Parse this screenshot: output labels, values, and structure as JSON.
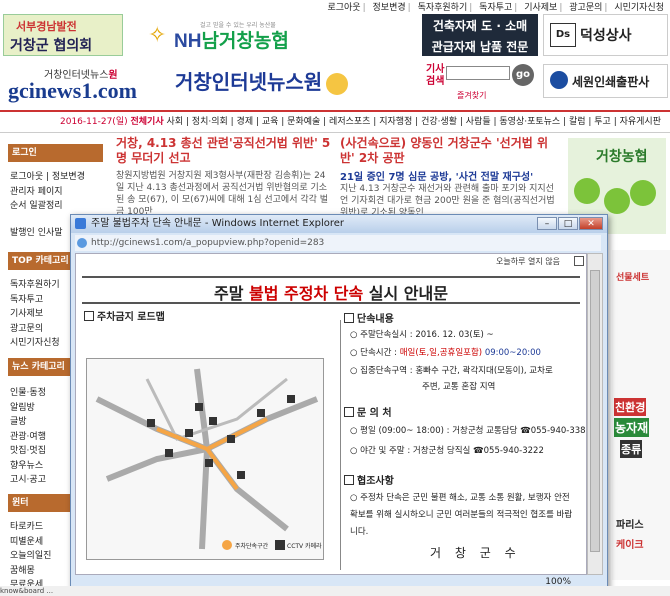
{
  "top_links": [
    "로그아웃",
    "정보변경",
    "독자후원하기",
    "독자투고",
    "기사제보",
    "광고문의",
    "시민기자신청"
  ],
  "banners": {
    "council_line1": "서부경남발전",
    "council_line2": "거창군 협의회",
    "nh_tagline": "걸고 믿을 수 있는 우리 농산물",
    "nh_name_a": "NH",
    "nh_name_b": "남거창농협",
    "building_line1": "건축자재 도 · 소매",
    "building_line2": "관급자재 납품 전문",
    "deoksung_logo": "Ds",
    "deoksung_name": "덕성상사",
    "sewon_name": "세원인쇄출판사"
  },
  "site": {
    "logo_top_a": "거창인터넷뉴스",
    "logo_top_b": "원",
    "logo_domain": "gcinews1.com",
    "title": "거창인터넷뉴스원",
    "search_label": "기사 검색",
    "search_go": "go",
    "favorite": "즐겨찾기"
  },
  "menubar": {
    "date": "2016-11-27(일)",
    "today": "전체기사",
    "items": "사회 | 정치·의회 | 경제 | 교육 | 문화예술 | 레저스포츠 | 지자행정 | 건강·생활 | 사람들 | 동영상·포토뉴스 | 칼럼 | 투고 | 자유게시판"
  },
  "sidebar": {
    "login_header": "로그인",
    "login_items": [
      "로그아웃 | 정보변경",
      "관리자 페이지",
      "순서 일괄정리"
    ],
    "mail_item": "발행인 인사말",
    "top_header": "TOP 카테고리",
    "top_items": [
      "독자후원하기",
      "독자투고",
      "기사제보",
      "광고문의",
      "시민기자신청"
    ],
    "news_header": "뉴스 카테고리",
    "news_items": [
      "인물·동정",
      "알림방",
      "글방",
      "관광·여행",
      "맛집·멋집",
      "향우뉴스",
      "고시·공고"
    ],
    "win_header": "윈터",
    "win_items": [
      "타로카드",
      "띠별운세",
      "오늘의일진",
      "꿈해몽",
      "무료운세"
    ]
  },
  "news": {
    "a_title": "거창, 4.13 총선 관련'공직선거법 위반' 5명 무더기 선고",
    "a_body": "창원지방법원 거창지원 제3형사부(재판장 김송휘)는 24일 지난 4.13 총선과정에서 공직선거법 위반혐의로 기소된 송 모(67), 이 모(67)씨에 대해 1심 선고에서 각각 벌금 100만",
    "b_title": "(사건속으로) 양동인 거창군수 '선거법 위반' 2차 공판",
    "b_sub": "21일 증인 7명 심문 공방, '사건 전말 재구성'",
    "b_body": "지난 4.13 거창군수 재선거와 관련해 출마 포기와 지지선언 기자회견 대가로 현금 200만 원을 준 혐의(공직선거법 위반)로 기소된 양동인"
  },
  "right": {
    "farm_title": "거창농협",
    "gift": "선물세트",
    "eco": "친환경",
    "material": "농자재",
    "kinds": "종류",
    "papalice": "파리스",
    "cake": "케이크"
  },
  "popup": {
    "window_title": "주말 불법주차 단속 안내문 - Windows Internet Explorer",
    "url": "http://gcinews1.com/a_popupview.php?openid=283",
    "close_today": "오늘하루 열지 않음",
    "title_a": "주말 ",
    "title_b": "불법 주정차 단속",
    "title_c": " 실시 안내문",
    "map_section": "주차금지 로드맵",
    "map_legend_a": "주차단속구간",
    "map_legend_b": "CCTV 카메라",
    "sec1": "단속내용",
    "sec1_rows": [
      {
        "label": "주말단속실시 : ",
        "value": "2016. 12. 03(토) ~"
      },
      {
        "label": "단속시간 : ",
        "value_red": "매일(토,일,공휴일포함)",
        "value_blue": "09:00~20:00"
      },
      {
        "label": "집중단속구역 : ",
        "value": "홍빠수 구간, 곽각지대(모동이), 교차로"
      },
      {
        "label": "",
        "value": "주변, 교통 혼잡 지역"
      }
    ],
    "sec2": "문 의 처",
    "sec2_rows": [
      {
        "label": "평일 (09:00~ 18:00) : ",
        "value": "거창군청 교통담당 ☎055-940-3385"
      },
      {
        "label": "야간 및 주말 : ",
        "value": "거창군청 당직실 ☎055-940-3222"
      }
    ],
    "sec3": "협조사항",
    "sec3_body": "주정차 단속은 군민 불편 해소, 교통 소통 원활, 보행자 안전 확보를 위해 실시하오니 군민 여러분들의 적극적인 협조를 바랍니다.",
    "signature": "거 창 군 수",
    "zoom": "100%"
  },
  "status_bar": "know&board ...",
  "colors": {
    "accent_red": "#cc0000",
    "nav_blue": "#1d3a96",
    "sidebar_brown": "#b86a2e"
  }
}
